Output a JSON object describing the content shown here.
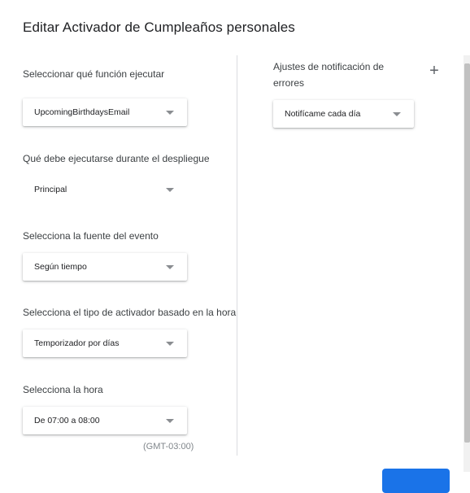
{
  "dialog": {
    "title": "Editar Activador de Cumpleaños personales"
  },
  "left": {
    "function_label": "Seleccionar qué función ejecutar",
    "function_value": "UpcomingBirthdaysEmail",
    "deployment_label": "Qué debe ejecutarse durante el despliegue",
    "deployment_value": "Principal",
    "event_source_label": "Selecciona la fuente del evento",
    "event_source_value": "Según tiempo",
    "trigger_type_label": "Selecciona el tipo de activador basado en la hora",
    "trigger_type_value": "Temporizador por días",
    "time_label": "Selecciona la hora",
    "time_value": "De 07:00 a 08:00",
    "timezone": "(GMT-03:00)"
  },
  "right": {
    "notification_label": "Ajustes de notificación de errores",
    "add_icon": "plus-icon",
    "notification_value": "Notifícame cada día"
  },
  "colors": {
    "primary_button": "#1a73e8",
    "divider": "#dadce0"
  }
}
